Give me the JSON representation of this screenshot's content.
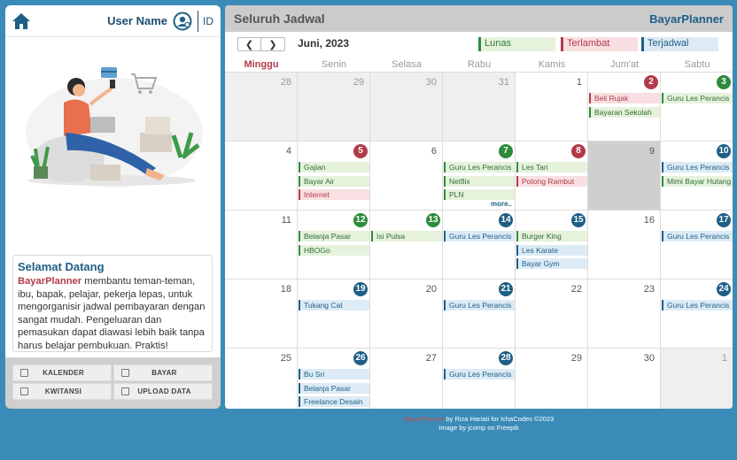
{
  "header": {
    "username": "User Name",
    "lang": "ID"
  },
  "welcome": {
    "title": "Selamat Datang",
    "brand": "BayarPlanner",
    "text": " membantu teman-teman, ibu, bapak, pelajar, pekerja lepas, untuk mengorganisir jadwal pembayaran dengan sangat mudah. Pengeluaran dan pemasukan dapat diawasi lebih baik tanpa harus belajar pembukuan. Praktis!"
  },
  "buttons": {
    "kalender": "KALENDER",
    "bayar": "BAYAR",
    "kwitansi": "KWITANSI",
    "upload": "UPLOAD DATA"
  },
  "calendar": {
    "title": "Seluruh Jadwal",
    "app": "BayarPlanner",
    "month": "Juni, 2023",
    "prev": "❮",
    "next": "❯",
    "legend": {
      "lunas": "Lunas",
      "terlambat": "Terlambat",
      "terjadwal": "Terjadwal"
    },
    "days": [
      "Minggu",
      "Senin",
      "Selasa",
      "Rabu",
      "Kamis",
      "Jum'at",
      "Sabtu"
    ],
    "more": "more..",
    "weeks": [
      [
        {
          "d": "28",
          "other": true,
          "ev": []
        },
        {
          "d": "29",
          "other": true,
          "ev": []
        },
        {
          "d": "30",
          "other": true,
          "ev": []
        },
        {
          "d": "31",
          "other": true,
          "ev": []
        },
        {
          "d": "1",
          "ev": []
        },
        {
          "d": "2",
          "badge": "red",
          "ev": [
            {
              "t": "Beli Rujak",
              "s": "r"
            },
            {
              "t": "Bayaran Sekolah",
              "s": "g"
            }
          ]
        },
        {
          "d": "3",
          "badge": "green",
          "ev": [
            {
              "t": "Guru Les Perancis",
              "s": "g"
            }
          ]
        }
      ],
      [
        {
          "d": "4",
          "ev": []
        },
        {
          "d": "5",
          "badge": "red",
          "ev": [
            {
              "t": "Gajian",
              "s": "g"
            },
            {
              "t": "Bayar Air",
              "s": "g"
            },
            {
              "t": "Internet",
              "s": "r"
            }
          ]
        },
        {
          "d": "6",
          "ev": []
        },
        {
          "d": "7",
          "badge": "green",
          "ev": [
            {
              "t": "Guru Les Perancis",
              "s": "g"
            },
            {
              "t": "Netflix",
              "s": "g"
            },
            {
              "t": "PLN",
              "s": "g"
            }
          ],
          "more": true
        },
        {
          "d": "8",
          "badge": "red",
          "ev": [
            {
              "t": "Les Tari",
              "s": "g"
            },
            {
              "t": "Potong Rambut",
              "s": "r"
            }
          ]
        },
        {
          "d": "9",
          "today": true,
          "ev": []
        },
        {
          "d": "10",
          "badge": "blue",
          "ev": [
            {
              "t": "Guru Les Perancis",
              "s": "b"
            },
            {
              "t": "Mimi Bayar Hutang",
              "s": "g"
            }
          ]
        }
      ],
      [
        {
          "d": "11",
          "ev": []
        },
        {
          "d": "12",
          "badge": "green",
          "ev": [
            {
              "t": "Belanja Pasar",
              "s": "g"
            },
            {
              "t": "HBOGo",
              "s": "g"
            }
          ]
        },
        {
          "d": "13",
          "badge": "green",
          "ev": [
            {
              "t": "Isi Pulsa",
              "s": "g"
            }
          ]
        },
        {
          "d": "14",
          "badge": "blue",
          "ev": [
            {
              "t": "Guru Les Perancis",
              "s": "b"
            }
          ]
        },
        {
          "d": "15",
          "badge": "blue",
          "ev": [
            {
              "t": "Burger King",
              "s": "g"
            },
            {
              "t": "Les Karate",
              "s": "b"
            },
            {
              "t": "Bayar Gym",
              "s": "b"
            }
          ]
        },
        {
          "d": "16",
          "ev": []
        },
        {
          "d": "17",
          "badge": "blue",
          "ev": [
            {
              "t": "Guru Les Perancis",
              "s": "b"
            }
          ]
        }
      ],
      [
        {
          "d": "18",
          "ev": []
        },
        {
          "d": "19",
          "badge": "blue",
          "ev": [
            {
              "t": "Tukang Cat",
              "s": "b"
            }
          ]
        },
        {
          "d": "20",
          "ev": []
        },
        {
          "d": "21",
          "badge": "blue",
          "ev": [
            {
              "t": "Guru Les Perancis",
              "s": "b"
            }
          ]
        },
        {
          "d": "22",
          "ev": []
        },
        {
          "d": "23",
          "ev": []
        },
        {
          "d": "24",
          "badge": "blue",
          "ev": [
            {
              "t": "Guru Les Perancis",
              "s": "b"
            }
          ]
        }
      ],
      [
        {
          "d": "25",
          "ev": []
        },
        {
          "d": "26",
          "badge": "blue",
          "ev": [
            {
              "t": "Bu Sri",
              "s": "b"
            },
            {
              "t": "Belanja Pasar",
              "s": "b"
            },
            {
              "t": "Freelance Desain",
              "s": "b"
            }
          ]
        },
        {
          "d": "27",
          "ev": []
        },
        {
          "d": "28",
          "badge": "blue",
          "ev": [
            {
              "t": "Guru Les Perancis",
              "s": "b"
            }
          ]
        },
        {
          "d": "29",
          "ev": []
        },
        {
          "d": "30",
          "ev": []
        },
        {
          "d": "1",
          "other": true,
          "ev": []
        }
      ]
    ]
  },
  "footer": {
    "brand": "BayarPlanner",
    "line1": " by Riza Hariati for IchaCodes ©2023",
    "line2": "Image by jcomp  on Freepik"
  },
  "colors": {
    "accent": "#1f5f86",
    "paid": "#2e8b3c",
    "late": "#b23a48",
    "background": "#3a8bb7"
  }
}
